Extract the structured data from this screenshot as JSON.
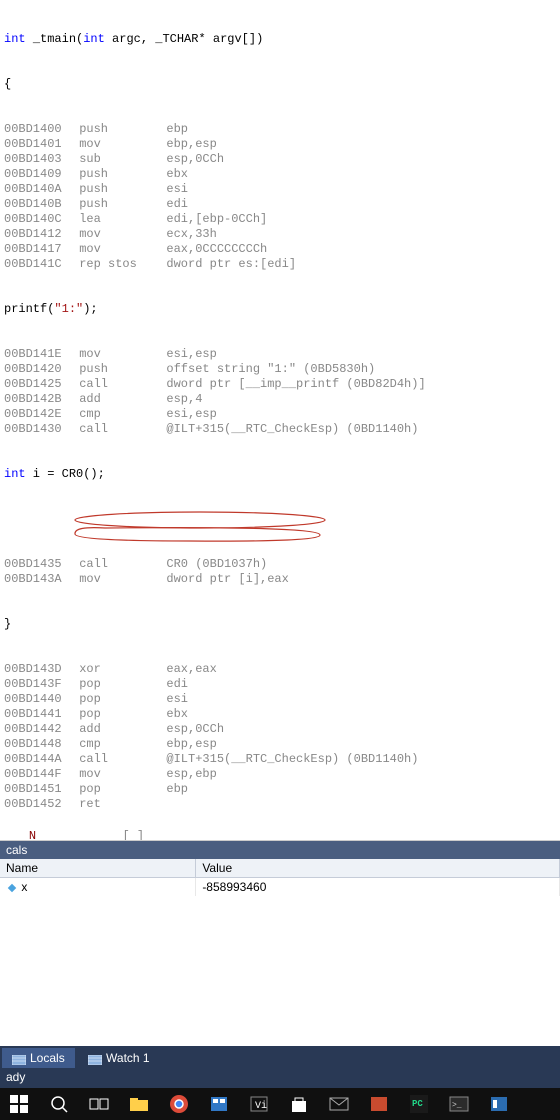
{
  "code": {
    "sig": {
      "kw1": "int",
      "name": "_tmain(",
      "kw2": "int",
      "mid": " argc, _TCHAR* argv[])"
    },
    "open_brace": "{",
    "lines1": [
      {
        "addr": "00BD1400",
        "mnem": "push",
        "ops": "ebp"
      },
      {
        "addr": "00BD1401",
        "mnem": "mov",
        "ops": "ebp,esp"
      },
      {
        "addr": "00BD1403",
        "mnem": "sub",
        "ops": "esp,0CCh"
      },
      {
        "addr": "00BD1409",
        "mnem": "push",
        "ops": "ebx"
      },
      {
        "addr": "00BD140A",
        "mnem": "push",
        "ops": "esi"
      },
      {
        "addr": "00BD140B",
        "mnem": "push",
        "ops": "edi"
      },
      {
        "addr": "00BD140C",
        "mnem": "lea",
        "ops": "edi,[ebp-0CCh]"
      },
      {
        "addr": "00BD1412",
        "mnem": "mov",
        "ops": "ecx,33h"
      },
      {
        "addr": "00BD1417",
        "mnem": "mov",
        "ops": "eax,0CCCCCCCCh"
      },
      {
        "addr": "00BD141C",
        "mnem": "rep stos",
        "ops": "dword ptr es:[edi]"
      }
    ],
    "printf_src": {
      "pre": "printf(",
      "str": "\"1:\"",
      "post": ");"
    },
    "lines2": [
      {
        "addr": "00BD141E",
        "mnem": "mov",
        "ops": "esi,esp"
      },
      {
        "addr": "00BD1420",
        "mnem": "push",
        "ops": "offset string \"1:\" (0BD5830h)"
      },
      {
        "addr": "00BD1425",
        "mnem": "call",
        "ops": "dword ptr [__imp__printf (0BD82D4h)]"
      },
      {
        "addr": "00BD142B",
        "mnem": "add",
        "ops": "esp,4"
      },
      {
        "addr": "00BD142E",
        "mnem": "cmp",
        "ops": "esi,esp"
      },
      {
        "addr": "00BD1430",
        "mnem": "call",
        "ops": "@ILT+315(__RTC_CheckEsp) (0BD1140h)"
      }
    ],
    "int_src_kw": "int",
    "int_src_rest": " i = CR0();",
    "lines3": [
      {
        "addr": "00BD1435",
        "mnem": "call",
        "ops": "CR0 (0BD1037h)"
      },
      {
        "addr": "00BD143A",
        "mnem": "mov",
        "ops": "dword ptr [i],eax"
      }
    ],
    "close_brace": "}",
    "lines4": [
      {
        "addr": "00BD143D",
        "mnem": "xor",
        "ops": "eax,eax"
      },
      {
        "addr": "00BD143F",
        "mnem": "pop",
        "ops": "edi"
      },
      {
        "addr": "00BD1440",
        "mnem": "pop",
        "ops": "esi"
      },
      {
        "addr": "00BD1441",
        "mnem": "pop",
        "ops": "ebx"
      },
      {
        "addr": "00BD1442",
        "mnem": "add",
        "ops": "esp,0CCh"
      },
      {
        "addr": "00BD1448",
        "mnem": "cmp",
        "ops": "ebp,esp"
      },
      {
        "addr": "00BD144A",
        "mnem": "call",
        "ops": "@ILT+315(__RTC_CheckEsp) (0BD1140h)"
      },
      {
        "addr": "00BD144F",
        "mnem": "mov",
        "ops": "esp,ebp"
      },
      {
        "addr": "00BD1451",
        "mnem": "pop",
        "ops": "ebp"
      },
      {
        "addr": "00BD1452",
        "mnem": "ret",
        "ops": ""
      }
    ]
  },
  "locals": {
    "title": "cals",
    "headers": {
      "name": "Name",
      "value": "Value"
    },
    "row": {
      "icon": "◆",
      "name": "x",
      "value": "-858993460"
    }
  },
  "tabs": {
    "t1": "Locals",
    "t2": "Watch 1"
  },
  "status": "ady"
}
